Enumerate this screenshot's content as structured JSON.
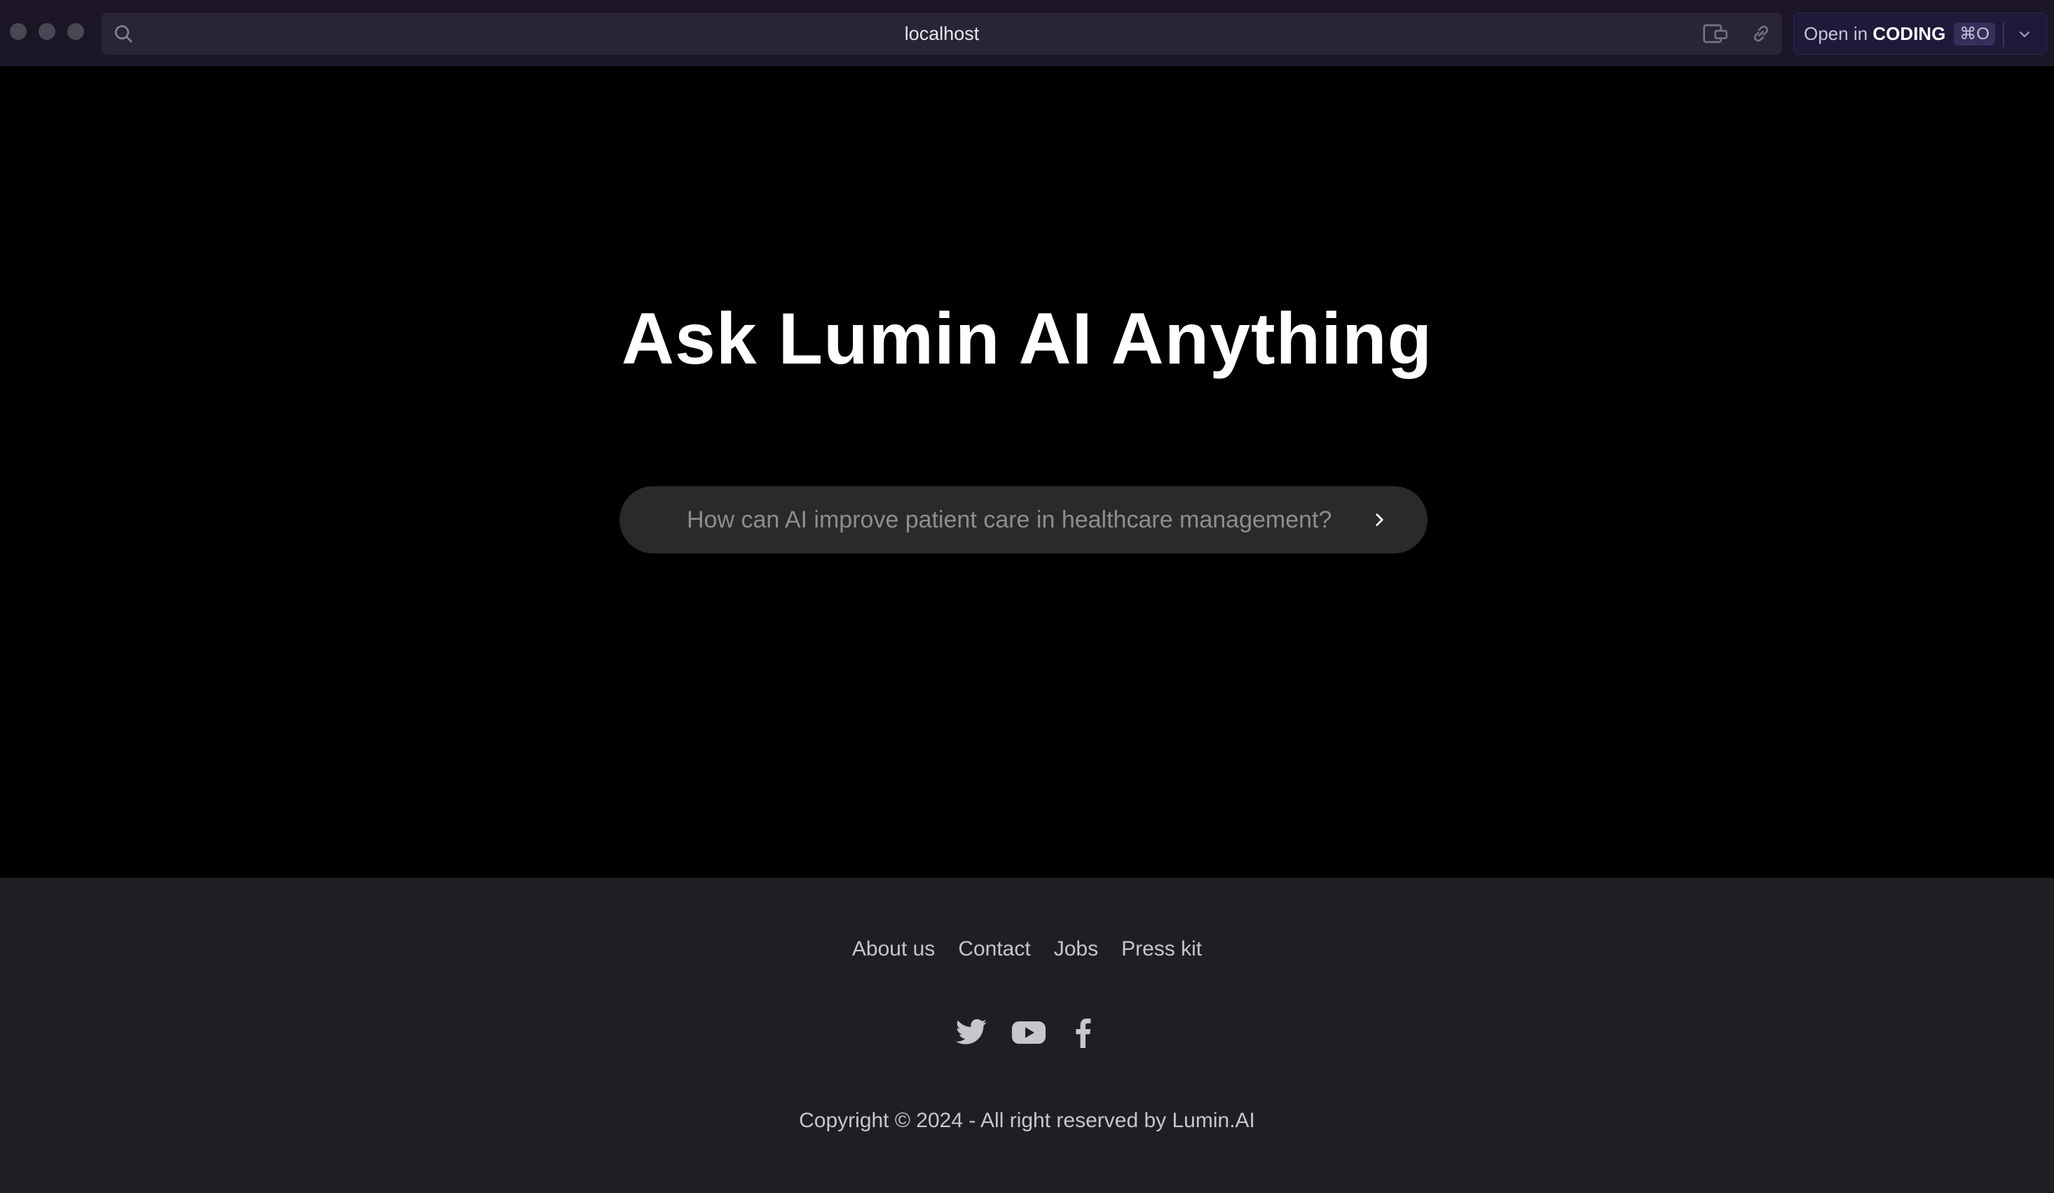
{
  "browser": {
    "url": "localhost",
    "open_in_prefix": "Open in ",
    "open_in_app": "CODING",
    "shortcut": "⌘O"
  },
  "hero": {
    "title": "Ask Lumin AI Anything",
    "search_placeholder": "How can AI improve patient care in healthcare management?"
  },
  "footer": {
    "links": [
      "About us",
      "Contact",
      "Jobs",
      "Press kit"
    ],
    "socials": [
      "twitter-icon",
      "youtube-icon",
      "facebook-icon"
    ],
    "copyright": "Copyright © 2024 - All right reserved by Lumin.AI"
  },
  "colors": {
    "page_bg": "#000000",
    "search_bg": "#2a2a2a",
    "footer_bg": "#1d1f23",
    "footer_text": "#c5c7cc"
  }
}
